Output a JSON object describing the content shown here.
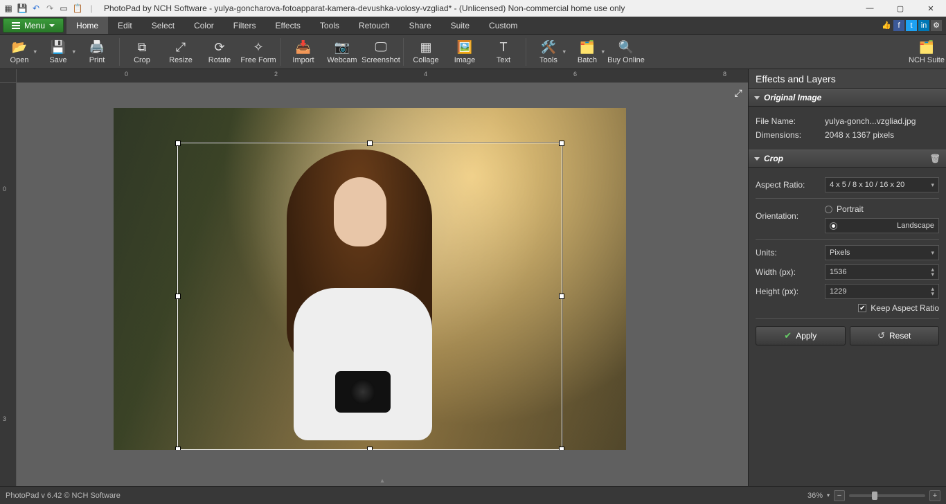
{
  "title": "PhotoPad by NCH Software - yulya-goncharova-fotoapparat-kamera-devushka-volosy-vzgliad* - (Unlicensed) Non-commercial home use only",
  "menu_button": "Menu",
  "menus": [
    "Home",
    "Edit",
    "Select",
    "Color",
    "Filters",
    "Effects",
    "Tools",
    "Retouch",
    "Share",
    "Suite",
    "Custom"
  ],
  "active_menu": "Home",
  "toolbar": [
    {
      "id": "open",
      "label": "Open",
      "drop": true
    },
    {
      "id": "save",
      "label": "Save",
      "drop": true
    },
    {
      "id": "print",
      "label": "Print"
    },
    {
      "sep": true
    },
    {
      "id": "crop",
      "label": "Crop"
    },
    {
      "id": "resize",
      "label": "Resize"
    },
    {
      "id": "rotate",
      "label": "Rotate"
    },
    {
      "id": "freeform",
      "label": "Free Form"
    },
    {
      "sep": true
    },
    {
      "id": "import",
      "label": "Import"
    },
    {
      "id": "webcam",
      "label": "Webcam"
    },
    {
      "id": "screenshot",
      "label": "Screenshot"
    },
    {
      "sep": true
    },
    {
      "id": "collage",
      "label": "Collage"
    },
    {
      "id": "image",
      "label": "Image"
    },
    {
      "id": "text",
      "label": "Text"
    },
    {
      "sep": true
    },
    {
      "id": "tools",
      "label": "Tools",
      "drop": true
    },
    {
      "id": "batch",
      "label": "Batch",
      "drop": true
    },
    {
      "id": "buy",
      "label": "Buy Online"
    }
  ],
  "toolbar_right": {
    "id": "nchsuite",
    "label": "NCH Suite"
  },
  "ruler_h": [
    "0",
    "2",
    "4",
    "6",
    "8"
  ],
  "ruler_v": [
    "0",
    "3"
  ],
  "panel": {
    "title": "Effects and Layers",
    "original": {
      "header": "Original Image",
      "filename_label": "File Name:",
      "filename": "yulya-gonch...vzgliad.jpg",
      "dimensions_label": "Dimensions:",
      "dimensions": "2048 x 1367 pixels"
    },
    "crop": {
      "header": "Crop",
      "aspect_label": "Aspect Ratio:",
      "aspect_value": "4 x 5 / 8 x 10 / 16 x 20",
      "orientation_label": "Orientation:",
      "orientation_portrait": "Portrait",
      "orientation_landscape": "Landscape",
      "orientation_selected": "Landscape",
      "units_label": "Units:",
      "units_value": "Pixels",
      "width_label": "Width (px):",
      "width_value": "1536",
      "height_label": "Height (px):",
      "height_value": "1229",
      "keep_aspect": "Keep Aspect Ratio",
      "keep_aspect_checked": true,
      "apply": "Apply",
      "reset": "Reset"
    }
  },
  "status": {
    "left": "PhotoPad v 6.42 © NCH Software",
    "zoom": "36%"
  }
}
